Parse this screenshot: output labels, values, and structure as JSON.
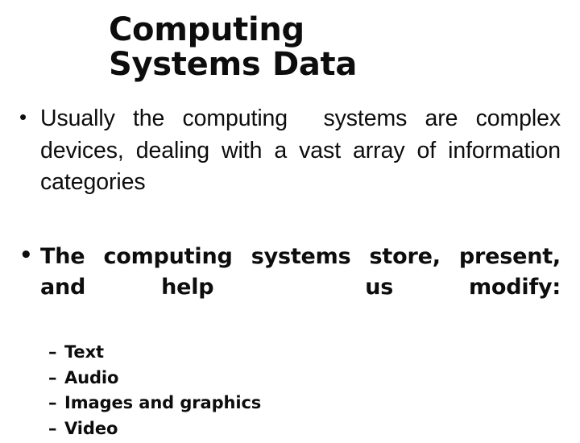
{
  "slide": {
    "background_color": "#ffffff",
    "text_color": "#0d0d0d",
    "title": "Computing Systems Data",
    "title_line_1": "Computing Systems",
    "title_line_2": "Data",
    "bullet_marker": "•",
    "sub_bullet_marker": "–",
    "bullets": [
      {
        "text": "Usually the computing  systems are complex devices, dealing with a vast array of information  categories",
        "style": "regular"
      },
      {
        "text": "The computing systems store, present, and help  us modify:",
        "style": "bold"
      }
    ],
    "sub_bullets": [
      {
        "label": "Text"
      },
      {
        "label": "Audio"
      },
      {
        "label": "Images and graphics"
      },
      {
        "label": "Video"
      }
    ]
  }
}
